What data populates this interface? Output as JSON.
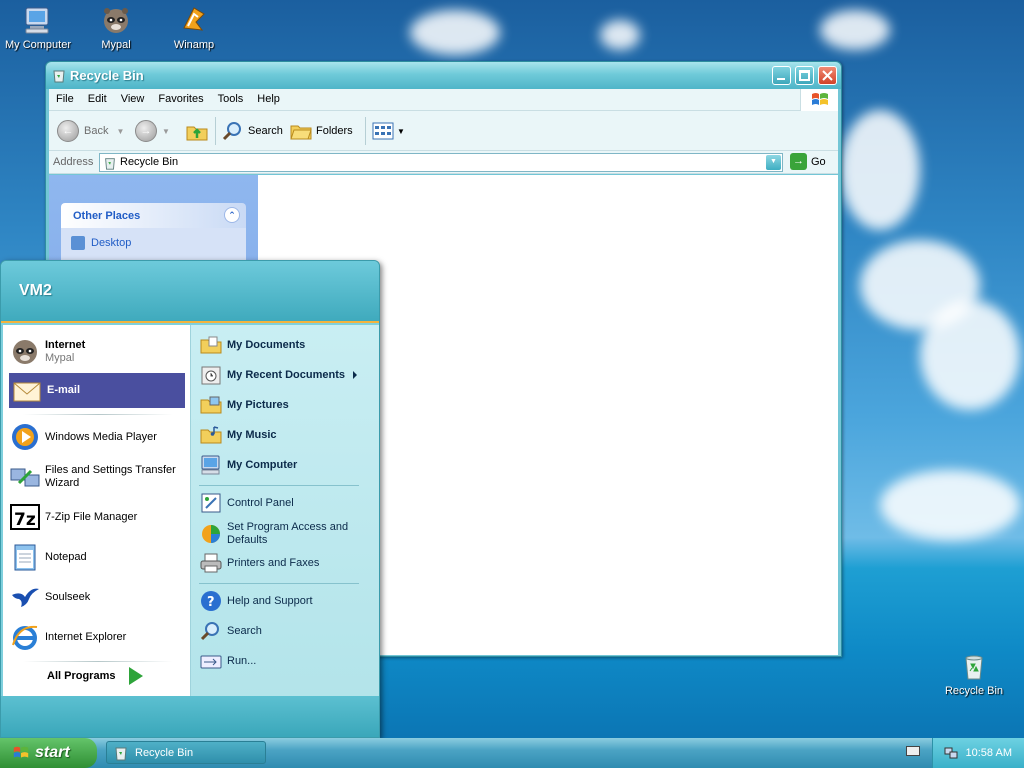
{
  "desktop": {
    "icons": [
      {
        "label": "My Computer"
      },
      {
        "label": "Mypal"
      },
      {
        "label": "Winamp"
      },
      {
        "label": "Recycle Bin"
      }
    ]
  },
  "window": {
    "title": "Recycle Bin",
    "menu": [
      "File",
      "Edit",
      "View",
      "Favorites",
      "Tools",
      "Help"
    ],
    "toolbar": {
      "back": "Back",
      "search": "Search",
      "folders": "Folders"
    },
    "address": {
      "label": "Address",
      "value": "Recycle Bin",
      "go": "Go"
    },
    "sidebar": {
      "section_title": "Other Places",
      "items": [
        "Desktop"
      ]
    }
  },
  "start_menu": {
    "user": "VM2",
    "pinned": [
      {
        "label": "Internet",
        "sub": "Mypal"
      },
      {
        "label": "E-mail"
      }
    ],
    "recent": [
      "Windows Media Player",
      "Files and Settings Transfer Wizard",
      "7-Zip File Manager",
      "Notepad",
      "Soulseek",
      "Internet Explorer"
    ],
    "all_programs": "All Programs",
    "right": {
      "group1": [
        "My Documents",
        "My Recent Documents",
        "My Pictures",
        "My Music",
        "My Computer"
      ],
      "group2": [
        "Control Panel",
        "Set Program Access and Defaults",
        "Printers and Faxes"
      ],
      "group3": [
        "Help and Support",
        "Search",
        "Run..."
      ]
    }
  },
  "taskbar": {
    "start": "start",
    "task": "Recycle Bin",
    "clock": "10:58 AM"
  }
}
